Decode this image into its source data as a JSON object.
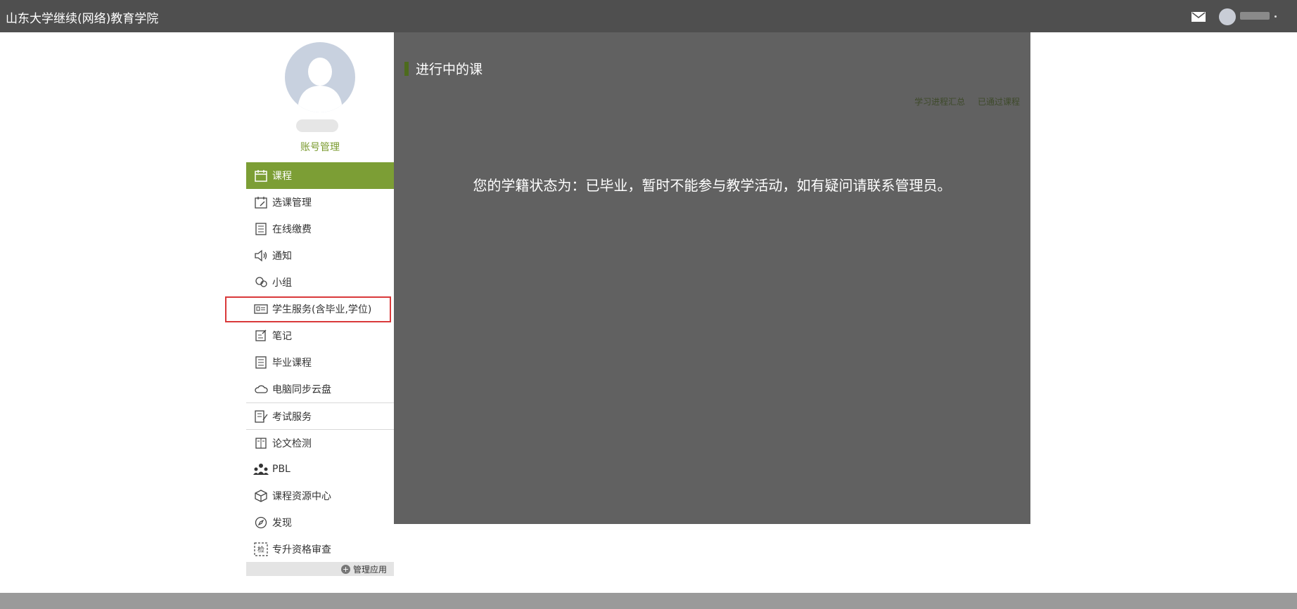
{
  "header": {
    "site_title": "山东大学继续(网络)教育学院"
  },
  "sidebar": {
    "account_label": "账号管理",
    "menu": [
      {
        "label": "课程",
        "icon": "calendar-icon",
        "active": true
      },
      {
        "label": "选课管理",
        "icon": "calendar-edit-icon"
      },
      {
        "label": "在线缴费",
        "icon": "document-list-icon"
      },
      {
        "label": "通知",
        "icon": "speaker-icon"
      },
      {
        "label": "小组",
        "icon": "group-icon"
      },
      {
        "label": "学生服务(含毕业,学位)",
        "icon": "id-card-icon",
        "highlighted": true
      },
      {
        "label": "笔记",
        "icon": "note-edit-icon"
      },
      {
        "label": "毕业课程",
        "icon": "document-list-icon"
      },
      {
        "label": "电脑同步云盘",
        "icon": "cloud-icon"
      },
      {
        "label": "考试服务",
        "icon": "exam-icon"
      },
      {
        "label": "论文检测",
        "icon": "book-icon"
      },
      {
        "label": "PBL",
        "icon": "people-icon"
      },
      {
        "label": "课程资源中心",
        "icon": "box-icon"
      },
      {
        "label": "发现",
        "icon": "compass-icon"
      },
      {
        "label": "专升资格审查",
        "icon": "check-stamp-icon"
      }
    ],
    "manage_apps_label": "管理应用"
  },
  "main": {
    "heading": "进行中的课",
    "link_progress": "学习进程汇总",
    "link_passed": "已通过课程",
    "status_message": "您的学籍状态为：已毕业，暂时不能参与教学活动，如有疑问请联系管理员。"
  },
  "colors": {
    "topbar": "#4f4f4f",
    "accent_green": "#7c9e35",
    "main_panel": "#616161",
    "highlight_red": "#d9393a"
  }
}
